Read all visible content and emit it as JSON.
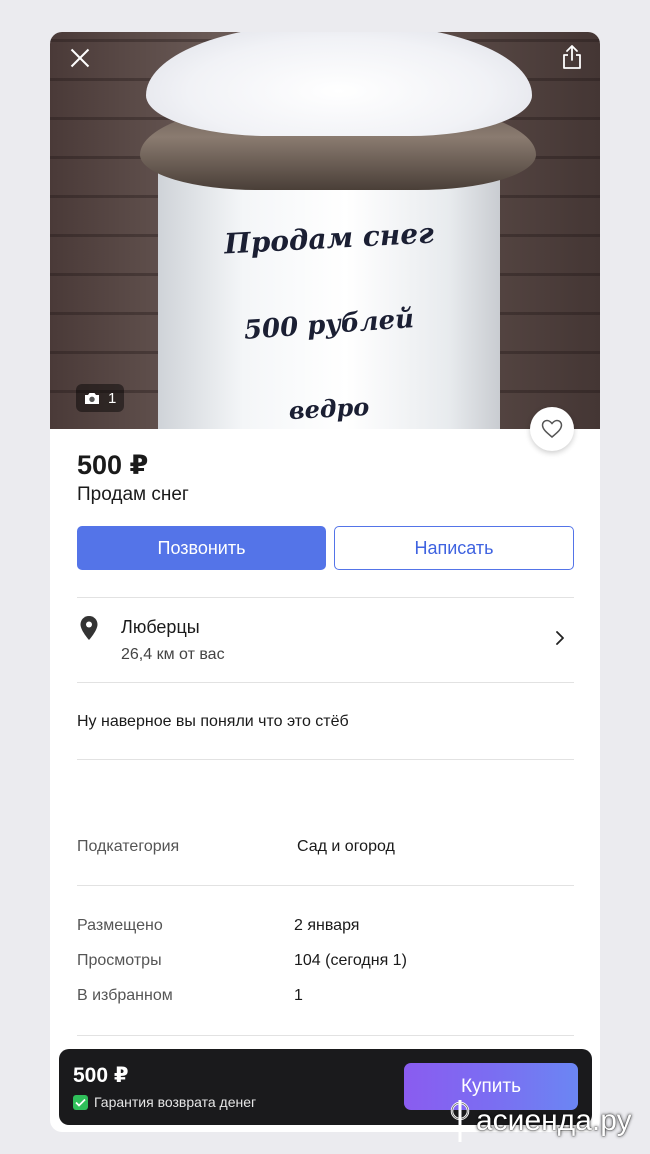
{
  "listing": {
    "photo_count": "1",
    "sign_lines": [
      "Продам снег",
      "500 рублей",
      "ведро"
    ],
    "price": "500 ₽",
    "title": "Продам снег"
  },
  "actions": {
    "call_label": "Позвонить",
    "write_label": "Написать"
  },
  "location": {
    "city": "Люберцы",
    "distance": "26,4 км от вас"
  },
  "description": "Ну наверное вы поняли что это стёб",
  "details": [
    {
      "label": "Подкатегория",
      "value": "Сад и огород"
    }
  ],
  "stats": [
    {
      "label": "Размещено",
      "value": "2 января"
    },
    {
      "label": "Просмотры",
      "value": "104 (сегодня 1)"
    },
    {
      "label": "В избранном",
      "value": "1"
    }
  ],
  "buy_bar": {
    "price": "500 ₽",
    "guarantee": "Гарантия возврата денег",
    "buy_label": "Купить"
  },
  "watermark": "асиенда.ру",
  "colors": {
    "primary": "#5474e8",
    "buy_gradient_start": "#8a5cf0",
    "buy_gradient_end": "#6b86f3",
    "check": "#2fbf5a"
  },
  "icons": [
    "close-icon",
    "share-icon",
    "camera-icon",
    "heart-icon",
    "location-pin-icon",
    "chevron-right-icon",
    "check-icon"
  ]
}
